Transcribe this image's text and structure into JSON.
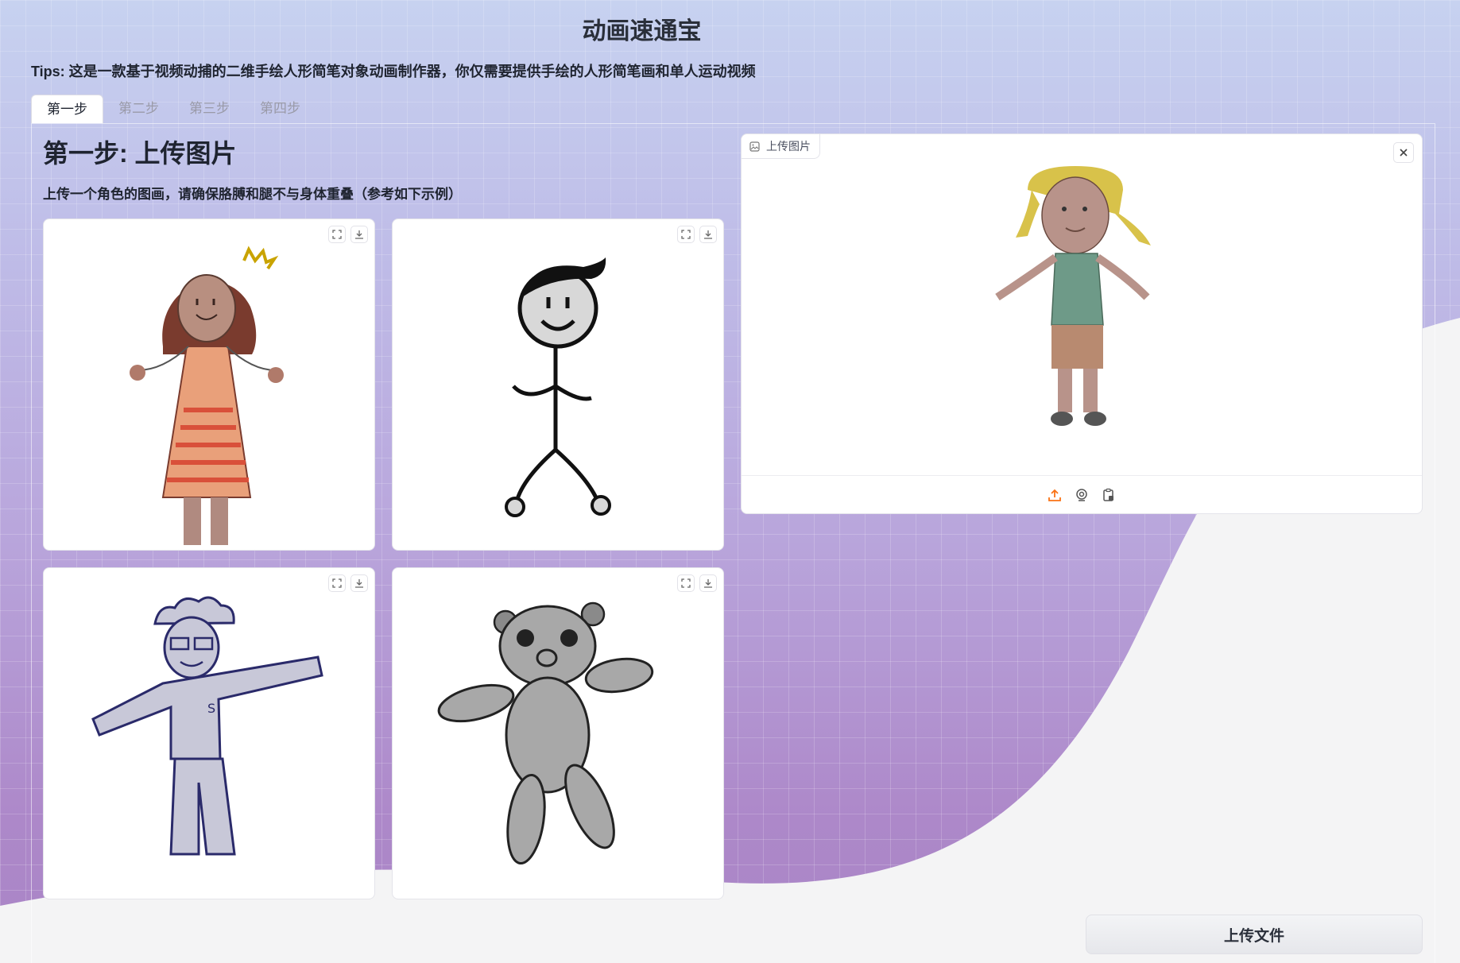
{
  "app": {
    "title": "动画速通宝"
  },
  "tips": "Tips: 这是一款基于视频动捕的二维手绘人形简笔对象动画制作器，你仅需要提供手绘的人形简笔画和单人运动视频",
  "tabs": [
    {
      "label": "第一步",
      "active": true
    },
    {
      "label": "第二步",
      "active": false
    },
    {
      "label": "第三步",
      "active": false
    },
    {
      "label": "第四步",
      "active": false
    }
  ],
  "step": {
    "title": "第一步: 上传图片",
    "description": "上传一个角色的图画，请确保胳膊和腿不与身体重叠（参考如下示例）"
  },
  "examples": [
    {
      "icon": "girl-drawing-icon"
    },
    {
      "icon": "stick-figure-drawing-icon"
    },
    {
      "icon": "boy-drawing-icon"
    },
    {
      "icon": "teddy-bear-drawing-icon"
    }
  ],
  "upload": {
    "label": "上传图片",
    "image_icon": "image-icon",
    "footer_icons": [
      "upload-icon",
      "webcam-icon",
      "clipboard-icon"
    ]
  },
  "submit": {
    "label": "上传文件"
  },
  "colors": {
    "accent": "#f97316",
    "bg_top": "#c7d2f0",
    "bg_bottom": "#a985c6"
  }
}
